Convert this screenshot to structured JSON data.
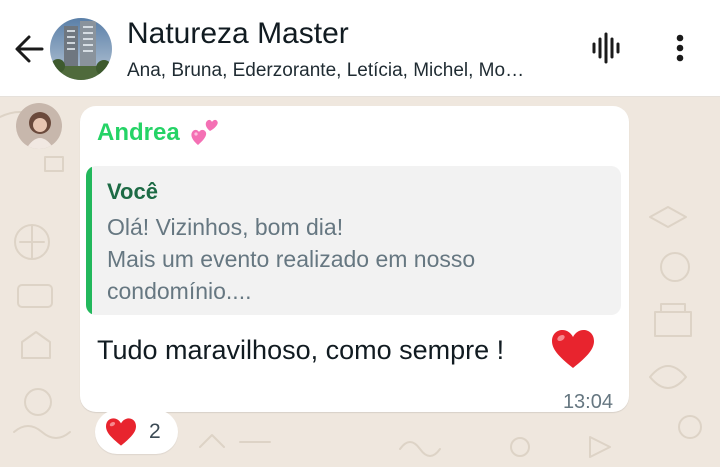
{
  "header": {
    "title": "Natureza Master",
    "members": "Ana, Bruna, Ederzorante, Letícia, Michel, Mo…",
    "back_icon": "arrow-left-icon",
    "voice_icon": "voice-waveform-icon",
    "menu_icon": "more-vertical-icon"
  },
  "message": {
    "sender": "Andrea",
    "sender_emoji": "two-hearts-emoji",
    "quote": {
      "author": "Você",
      "line1": "Olá! Vizinhos, bom dia!",
      "line2": "Mais um evento realizado em nosso",
      "line3": "condomínio...."
    },
    "text": "Tudo maravilhoso, como sempre !",
    "text_emoji": "red-heart-emoji",
    "time": "13:04",
    "reaction": {
      "emoji": "red-heart-emoji",
      "count": "2"
    }
  },
  "colors": {
    "sender_name": "#25d366",
    "quote_author": "#1d6b45",
    "quote_bar": "#22b85c",
    "heart": "#e8242e",
    "chat_background": "#efe7de"
  }
}
